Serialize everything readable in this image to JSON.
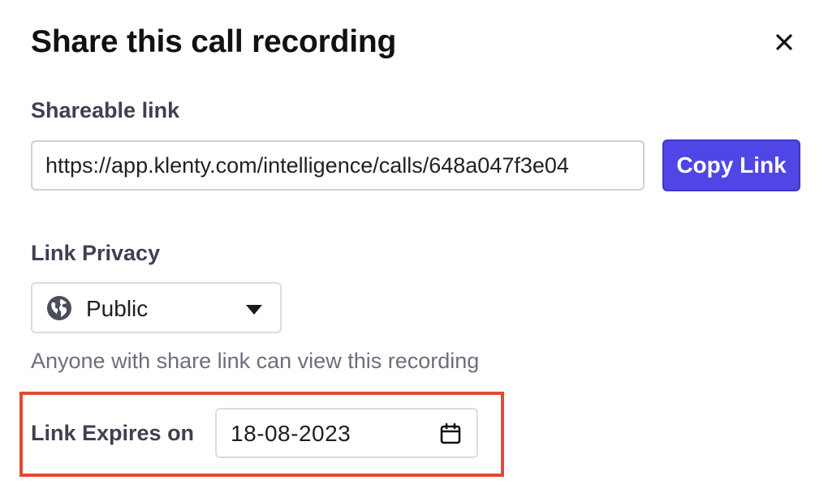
{
  "dialog": {
    "title": "Share this call recording",
    "close_icon": "close-icon"
  },
  "shareable_link": {
    "label": "Shareable link",
    "value": "https://app.klenty.com/intelligence/calls/648a047f3e04",
    "copy_label": "Copy Link"
  },
  "privacy": {
    "label": "Link Privacy",
    "selected": "Public",
    "icon": "globe-icon",
    "helper": "Anyone with share link can view this recording"
  },
  "expiry": {
    "label": "Link Expires on",
    "date": "18-08-2023",
    "icon": "calendar-icon"
  },
  "colors": {
    "accent": "#4f46e5",
    "highlight": "#e24a33",
    "label": "#3d4150",
    "helper": "#6b6f7a"
  }
}
